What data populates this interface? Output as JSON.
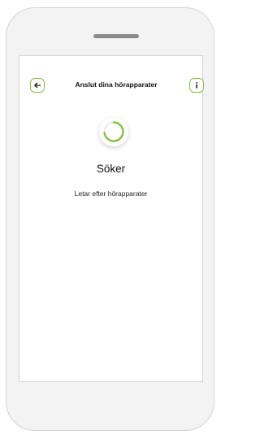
{
  "header": {
    "title": "Anslut dina hörapparater",
    "back_icon": "arrow-left-icon",
    "info_icon": "info-icon"
  },
  "status": {
    "heading": "Söker",
    "subtext": "Letar efter hörapparater"
  },
  "colors": {
    "accent": "#84c341",
    "frame": "#f3f3f3",
    "speaker": "#8a8a8a"
  }
}
